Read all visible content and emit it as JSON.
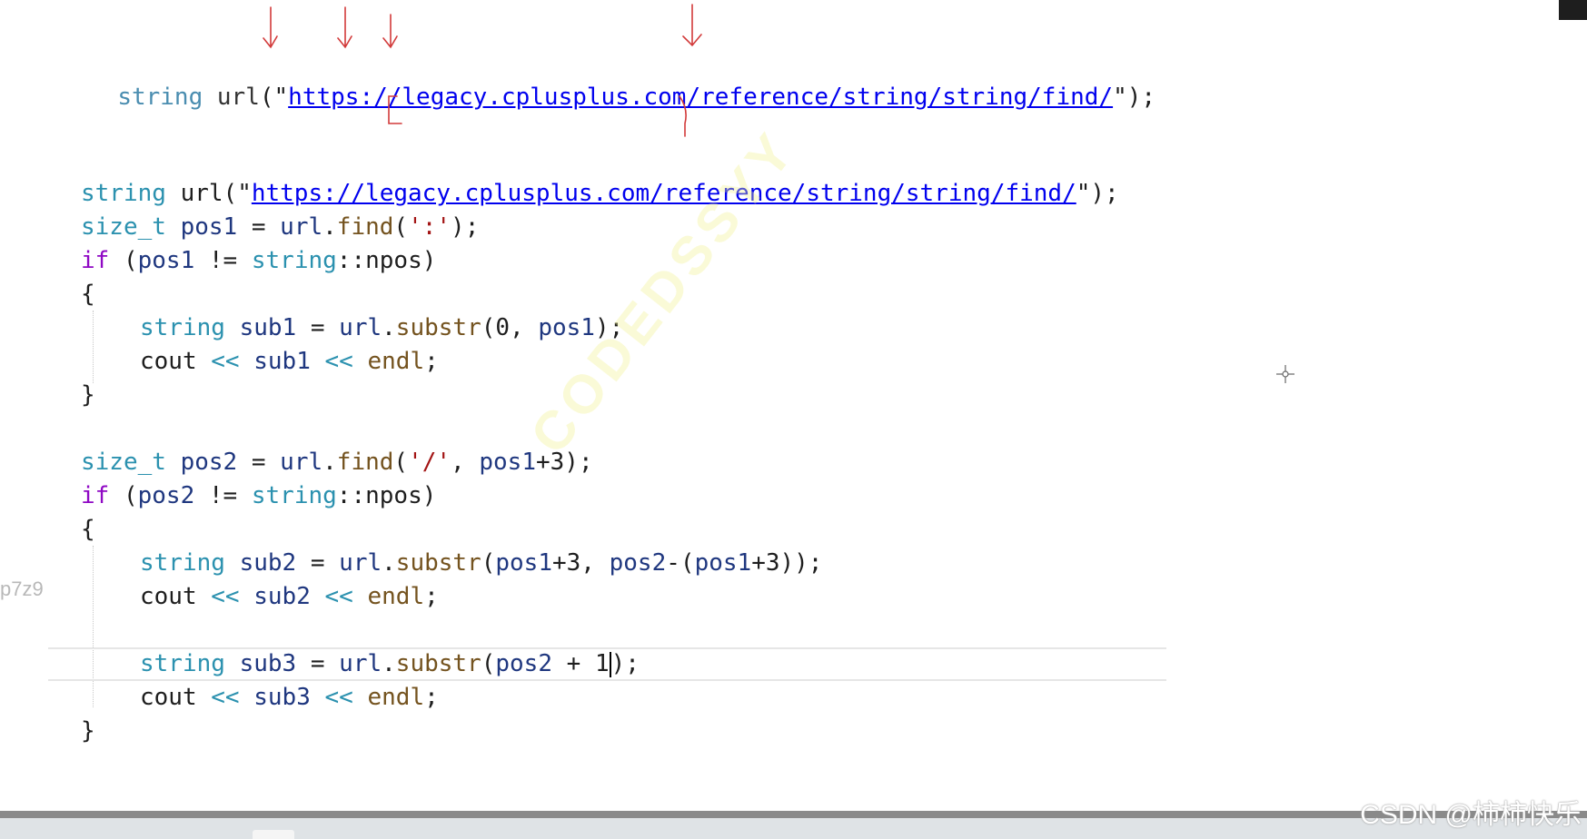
{
  "editor": {
    "header_line": {
      "type": "string",
      "var": "url",
      "open": "(\"",
      "url": "https://legacy.cplusplus.com/reference/string/string/find/",
      "close": "\");"
    },
    "lines": [
      {
        "indent": 0,
        "tokens": [
          {
            "t": "string",
            "c": "kw"
          },
          {
            "t": " url(\"",
            "c": ""
          },
          {
            "t": "https://legacy.cplusplus.com/reference/string/string/find/",
            "c": "url"
          },
          {
            "t": "\");",
            "c": ""
          }
        ]
      },
      {
        "indent": 0,
        "tokens": [
          {
            "t": "size_t",
            "c": "kw"
          },
          {
            "t": " ",
            "c": ""
          },
          {
            "t": "pos1",
            "c": "var"
          },
          {
            "t": " = ",
            "c": ""
          },
          {
            "t": "url",
            "c": "var"
          },
          {
            "t": ".",
            "c": ""
          },
          {
            "t": "find",
            "c": "fn"
          },
          {
            "t": "(",
            "c": ""
          },
          {
            "t": "':'",
            "c": "str"
          },
          {
            "t": ");",
            "c": ""
          }
        ]
      },
      {
        "indent": 0,
        "tokens": [
          {
            "t": "if",
            "c": "ctl"
          },
          {
            "t": " (",
            "c": ""
          },
          {
            "t": "pos1",
            "c": "var"
          },
          {
            "t": " != ",
            "c": ""
          },
          {
            "t": "string",
            "c": "kw"
          },
          {
            "t": "::npos)",
            "c": ""
          }
        ]
      },
      {
        "indent": 0,
        "tokens": [
          {
            "t": "{",
            "c": ""
          }
        ]
      },
      {
        "indent": 1,
        "tokens": [
          {
            "t": "string",
            "c": "kw"
          },
          {
            "t": " ",
            "c": ""
          },
          {
            "t": "sub1",
            "c": "var"
          },
          {
            "t": " = ",
            "c": ""
          },
          {
            "t": "url",
            "c": "var"
          },
          {
            "t": ".",
            "c": ""
          },
          {
            "t": "substr",
            "c": "fn"
          },
          {
            "t": "(0, ",
            "c": ""
          },
          {
            "t": "pos1",
            "c": "var"
          },
          {
            "t": ");",
            "c": ""
          }
        ]
      },
      {
        "indent": 1,
        "tokens": [
          {
            "t": "cout",
            "c": ""
          },
          {
            "t": " << ",
            "c": "kw"
          },
          {
            "t": "sub1",
            "c": "var"
          },
          {
            "t": " << ",
            "c": "kw"
          },
          {
            "t": "endl",
            "c": "fn"
          },
          {
            "t": ";",
            "c": ""
          }
        ]
      },
      {
        "indent": 0,
        "tokens": [
          {
            "t": "}",
            "c": ""
          }
        ]
      },
      {
        "indent": 0,
        "tokens": []
      },
      {
        "indent": 0,
        "tokens": [
          {
            "t": "size_t",
            "c": "kw"
          },
          {
            "t": " ",
            "c": ""
          },
          {
            "t": "pos2",
            "c": "var"
          },
          {
            "t": " = ",
            "c": ""
          },
          {
            "t": "url",
            "c": "var"
          },
          {
            "t": ".",
            "c": ""
          },
          {
            "t": "find",
            "c": "fn"
          },
          {
            "t": "(",
            "c": ""
          },
          {
            "t": "'/'",
            "c": "str"
          },
          {
            "t": ", ",
            "c": ""
          },
          {
            "t": "pos1",
            "c": "var"
          },
          {
            "t": "+3);",
            "c": ""
          }
        ]
      },
      {
        "indent": 0,
        "tokens": [
          {
            "t": "if",
            "c": "ctl"
          },
          {
            "t": " (",
            "c": ""
          },
          {
            "t": "pos2",
            "c": "var"
          },
          {
            "t": " != ",
            "c": ""
          },
          {
            "t": "string",
            "c": "kw"
          },
          {
            "t": "::npos)",
            "c": ""
          }
        ]
      },
      {
        "indent": 0,
        "tokens": [
          {
            "t": "{",
            "c": ""
          }
        ]
      },
      {
        "indent": 1,
        "tokens": [
          {
            "t": "string",
            "c": "kw"
          },
          {
            "t": " ",
            "c": ""
          },
          {
            "t": "sub2",
            "c": "var"
          },
          {
            "t": " = ",
            "c": ""
          },
          {
            "t": "url",
            "c": "var"
          },
          {
            "t": ".",
            "c": ""
          },
          {
            "t": "substr",
            "c": "fn"
          },
          {
            "t": "(",
            "c": ""
          },
          {
            "t": "pos1",
            "c": "var"
          },
          {
            "t": "+3, ",
            "c": ""
          },
          {
            "t": "pos2",
            "c": "var"
          },
          {
            "t": "-(",
            "c": ""
          },
          {
            "t": "pos1",
            "c": "var"
          },
          {
            "t": "+3));",
            "c": ""
          }
        ]
      },
      {
        "indent": 1,
        "tokens": [
          {
            "t": "cout",
            "c": ""
          },
          {
            "t": " << ",
            "c": "kw"
          },
          {
            "t": "sub2",
            "c": "var"
          },
          {
            "t": " << ",
            "c": "kw"
          },
          {
            "t": "endl",
            "c": "fn"
          },
          {
            "t": ";",
            "c": ""
          }
        ]
      },
      {
        "indent": 0,
        "tokens": []
      },
      {
        "indent": 1,
        "current": true,
        "tokens": [
          {
            "t": "string",
            "c": "kw"
          },
          {
            "t": " ",
            "c": ""
          },
          {
            "t": "sub3",
            "c": "var"
          },
          {
            "t": " = ",
            "c": ""
          },
          {
            "t": "url",
            "c": "var"
          },
          {
            "t": ".",
            "c": ""
          },
          {
            "t": "substr",
            "c": "fn"
          },
          {
            "t": "(",
            "c": ""
          },
          {
            "t": "pos2",
            "c": "var"
          },
          {
            "t": " + 1",
            "c": ""
          },
          {
            "t": "|",
            "c": "cursor"
          },
          {
            "t": ");",
            "c": ""
          }
        ]
      },
      {
        "indent": 1,
        "tokens": [
          {
            "t": "cout",
            "c": ""
          },
          {
            "t": " << ",
            "c": "kw"
          },
          {
            "t": "sub3",
            "c": "var"
          },
          {
            "t": " << ",
            "c": "kw"
          },
          {
            "t": "endl",
            "c": "fn"
          },
          {
            "t": ";",
            "c": ""
          }
        ]
      },
      {
        "indent": 0,
        "tokens": [
          {
            "t": "}",
            "c": ""
          }
        ]
      }
    ]
  },
  "gutter_text": "p7z9",
  "watermark": "CODEDSSYY",
  "footer": {
    "credit": "CSDN @柿柿快乐"
  },
  "colors": {
    "keyword": "#2b91af",
    "control": "#8f08c4",
    "function": "#74531f",
    "variable": "#1f377f",
    "string": "#a31515",
    "link": "#0000ee",
    "annotation_ink": "#d23a3a"
  }
}
